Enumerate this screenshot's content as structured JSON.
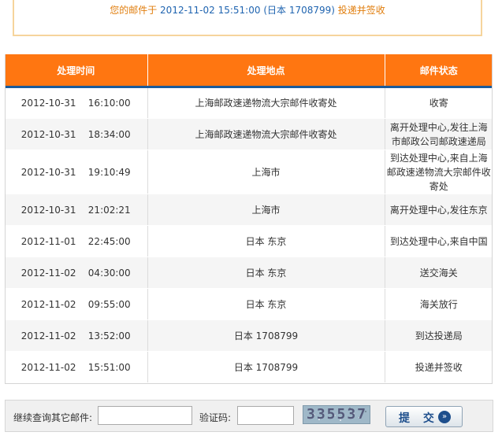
{
  "notice": {
    "prefix": "您的邮件于 ",
    "datetime": "2012-11-02 15:51:00",
    "place": "(日本 1708799)",
    "suffix": " 投递并签收"
  },
  "table": {
    "headers": {
      "time": "处理时间",
      "location": "处理地点",
      "status": "邮件状态"
    },
    "rows": [
      {
        "time": "2012-10-31    16:10:00",
        "location": "上海邮政速递物流大宗邮件收寄处",
        "status": "收寄"
      },
      {
        "time": "2012-10-31    18:34:00",
        "location": "上海邮政速递物流大宗邮件收寄处",
        "status": "离开处理中心,发往上海市邮政公司邮政速递局"
      },
      {
        "time": "2012-10-31    19:10:49",
        "location": "上海市",
        "status": "到达处理中心,来自上海邮政速递物流大宗邮件收寄处"
      },
      {
        "time": "2012-10-31    21:02:21",
        "location": "上海市",
        "status": "离开处理中心,发往东京"
      },
      {
        "time": "2012-11-01    22:45:00",
        "location": "日本 东京",
        "status": "到达处理中心,来自中国"
      },
      {
        "time": "2012-11-02    04:30:00",
        "location": "日本 东京",
        "status": "送交海关"
      },
      {
        "time": "2012-11-02    09:55:00",
        "location": "日本 东京",
        "status": "海关放行"
      },
      {
        "time": "2012-11-02    13:52:00",
        "location": "日本 1708799",
        "status": "到达投递局"
      },
      {
        "time": "2012-11-02    15:51:00",
        "location": "日本 1708799",
        "status": "投递并签收"
      }
    ]
  },
  "query": {
    "mail_label": "继续查询其它邮件:",
    "mail_value": "",
    "code_label": "验证码:",
    "code_value": "",
    "captcha_text": "335537",
    "submit_label": "提 交"
  },
  "colors": {
    "header_bg": "#ff7611",
    "header_rule": "#1b5a99",
    "notice_text": "#e07d0c",
    "notice_highlight": "#1f64b0"
  }
}
